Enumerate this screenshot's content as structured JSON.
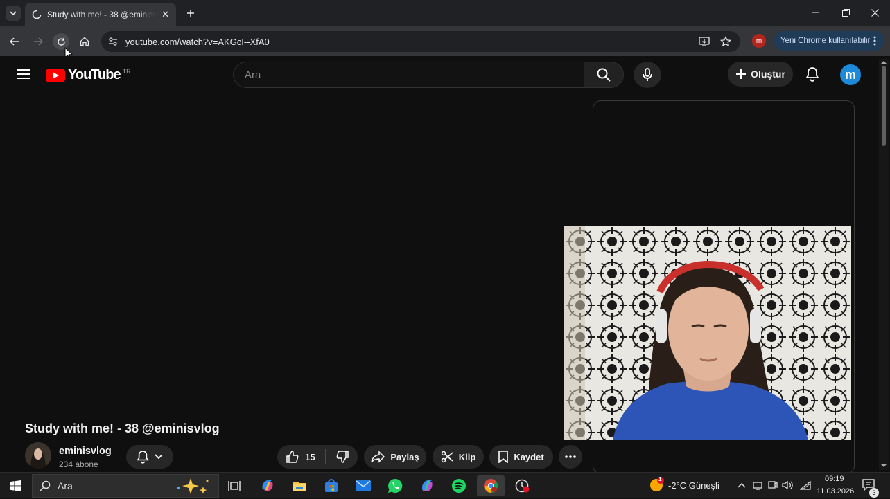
{
  "browser": {
    "tab_title": "Study with me! - 38 @eminisvlog",
    "url": "youtube.com/watch?v=AKGcI--XfA0",
    "profile_initial": "m",
    "banner": "Yeni Chrome kullanılabilir"
  },
  "youtube": {
    "logo_text": "YouTube",
    "country_code": "TR",
    "search_placeholder": "Ara",
    "create_label": "Oluştur",
    "account_initial": "m",
    "video_title": "Study with me! - 38 @eminisvlog",
    "channel_name": "eminisvlog",
    "subscribers": "234 abone",
    "like_count": "15",
    "share_label": "Paylaş",
    "clip_label": "Klip",
    "save_label": "Kaydet"
  },
  "taskbar": {
    "search_label": "Ara",
    "weather": "-2°C  Güneşli",
    "weather_badge": "1",
    "time": "09:19",
    "date": "11.03.2026",
    "notification_count": "3"
  },
  "colors": {
    "yt_red": "#ff0000",
    "account_blue": "#1c8ad8",
    "chrome_dark": "#202124"
  }
}
